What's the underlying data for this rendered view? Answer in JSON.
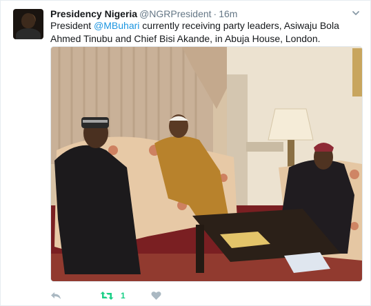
{
  "tweet": {
    "display_name": "Presidency Nigeria",
    "handle": "@NGRPresident",
    "separator": "·",
    "time": "16m",
    "text_before": "President ",
    "mention": "@MBuhari",
    "text_after": " currently receiving party leaders, Asiwaju Bola Ahmed Tinubu and Chief Bisi Akande, in Abuja House, London.",
    "retweet_count": "1"
  },
  "icons": {
    "more": "chevron-down-icon",
    "reply": "reply-icon",
    "retweet": "retweet-icon",
    "like": "heart-icon"
  },
  "colors": {
    "name": "#14171a",
    "meta": "#657786",
    "link": "#1b95e0",
    "retweet_active": "#19cf86",
    "action_idle": "#aab8c2"
  }
}
